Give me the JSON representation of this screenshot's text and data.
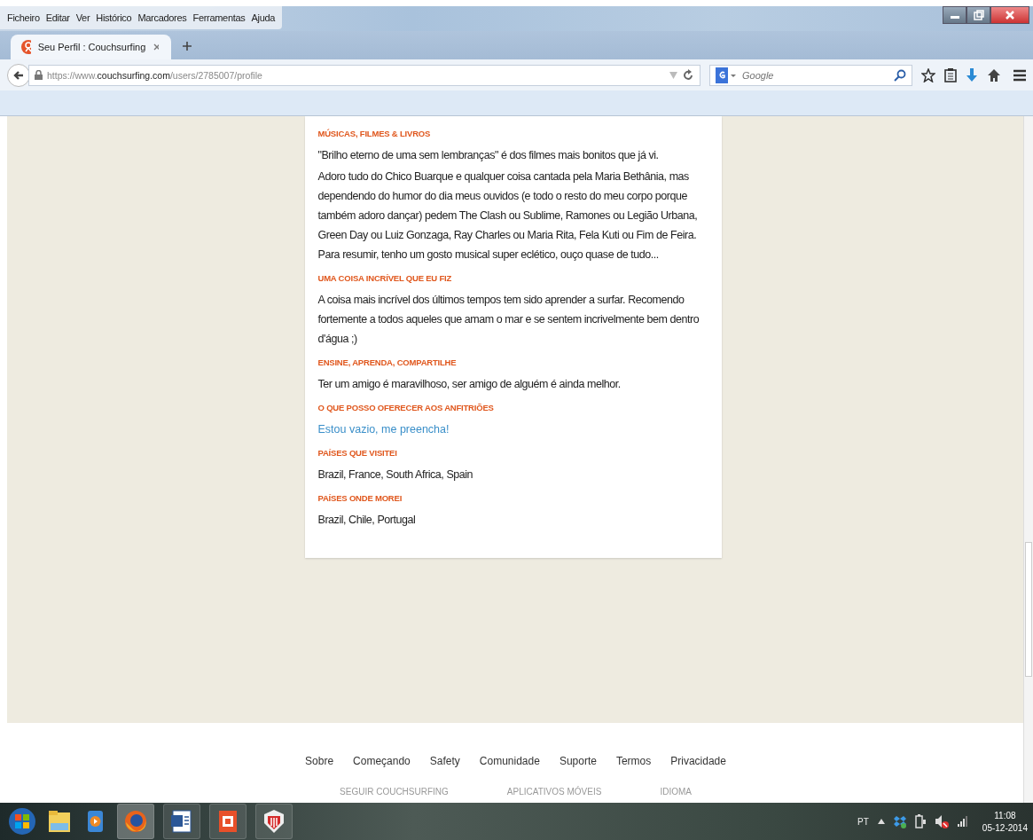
{
  "menu_bar": [
    "Ficheiro",
    "Editar",
    "Ver",
    "Histórico",
    "Marcadores",
    "Ferramentas",
    "Ajuda"
  ],
  "tabs": [
    {
      "label": "Seu Perfil : Couchsurfing",
      "selected": true
    }
  ],
  "address_bar": {
    "scheme": "https://www.",
    "domain": "couchsurfing.com",
    "path": "/users/2785007/profile"
  },
  "search": {
    "placeholder": "Google"
  },
  "sections": [
    {
      "heading": "MÚSICAS, FILMES & LIVROS",
      "kind": "text",
      "paragraphs": [
        "\"Brilho eterno de uma sem lembranças\" é dos filmes mais bonitos que já vi.",
        "Adoro tudo do Chico Buarque e qualquer coisa cantada pela Maria Bethânia, mas dependendo do humor do dia meus ouvidos (e todo o resto do meu corpo porque também adoro dançar) pedem The Clash ou Sublime, Ramones ou Legião Urbana, Green Day ou Luiz Gonzaga, Ray Charles ou Maria Rita, Fela Kuti ou Fim de Feira. Para resumir, tenho um gosto musical super eclético, ouço quase de tudo..."
      ]
    },
    {
      "heading": "UMA COISA INCRÍVEL QUE EU FIZ",
      "kind": "text",
      "paragraphs": [
        "A coisa mais incrível dos últimos tempos tem sido aprender a surfar. Recomendo fortemente a todos aqueles que amam o mar e se sentem incrivelmente bem dentro d'água ;)"
      ]
    },
    {
      "heading": "ENSINE, APRENDA, COMPARTILHE",
      "kind": "text",
      "paragraphs": [
        "Ter um amigo é maravilhoso, ser amigo de alguém é ainda melhor."
      ]
    },
    {
      "heading": "O QUE POSSO OFERECER AOS ANFITRIÕES",
      "kind": "link",
      "paragraphs": [
        "Estou vazio, me preencha!"
      ]
    },
    {
      "heading": "PAÍSES QUE VISITEI",
      "kind": "text",
      "paragraphs": [
        "Brazil, France, South Africa, Spain"
      ]
    },
    {
      "heading": "PAÍSES ONDE MOREI",
      "kind": "text",
      "paragraphs": [
        "Brazil, Chile, Portugal"
      ]
    }
  ],
  "footer_links": [
    "Sobre",
    "Começando",
    "Safety",
    "Comunidade",
    "Suporte",
    "Termos",
    "Privacidade"
  ],
  "footer_headings": [
    "SEGUIR COUCHSURFING",
    "APLICATIVOS MÓVEIS",
    "IDIOMA"
  ],
  "taskbar": {
    "language": "PT",
    "time": "11:08",
    "date": "05-12-2014"
  }
}
